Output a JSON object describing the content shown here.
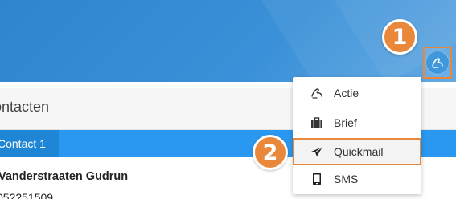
{
  "section": {
    "title": "ontacten"
  },
  "tabs": {
    "active_label": "Contact 1"
  },
  "contact": {
    "name": "Vanderstraaten Gudrun",
    "phone": "052251509"
  },
  "badges": {
    "first": "1",
    "second": "2"
  },
  "actions_menu": {
    "items": [
      {
        "label": "Actie",
        "icon": "action-swirl-icon"
      },
      {
        "label": "Brief",
        "icon": "briefcase-icon"
      },
      {
        "label": "Quickmail",
        "icon": "paper-plane-icon"
      },
      {
        "label": "SMS",
        "icon": "mobile-phone-icon"
      }
    ]
  },
  "colors": {
    "header": "#3b91d8",
    "tab_bar": "#2a98f0",
    "tab_active": "#1f86d6",
    "highlight": "#e9873a"
  }
}
